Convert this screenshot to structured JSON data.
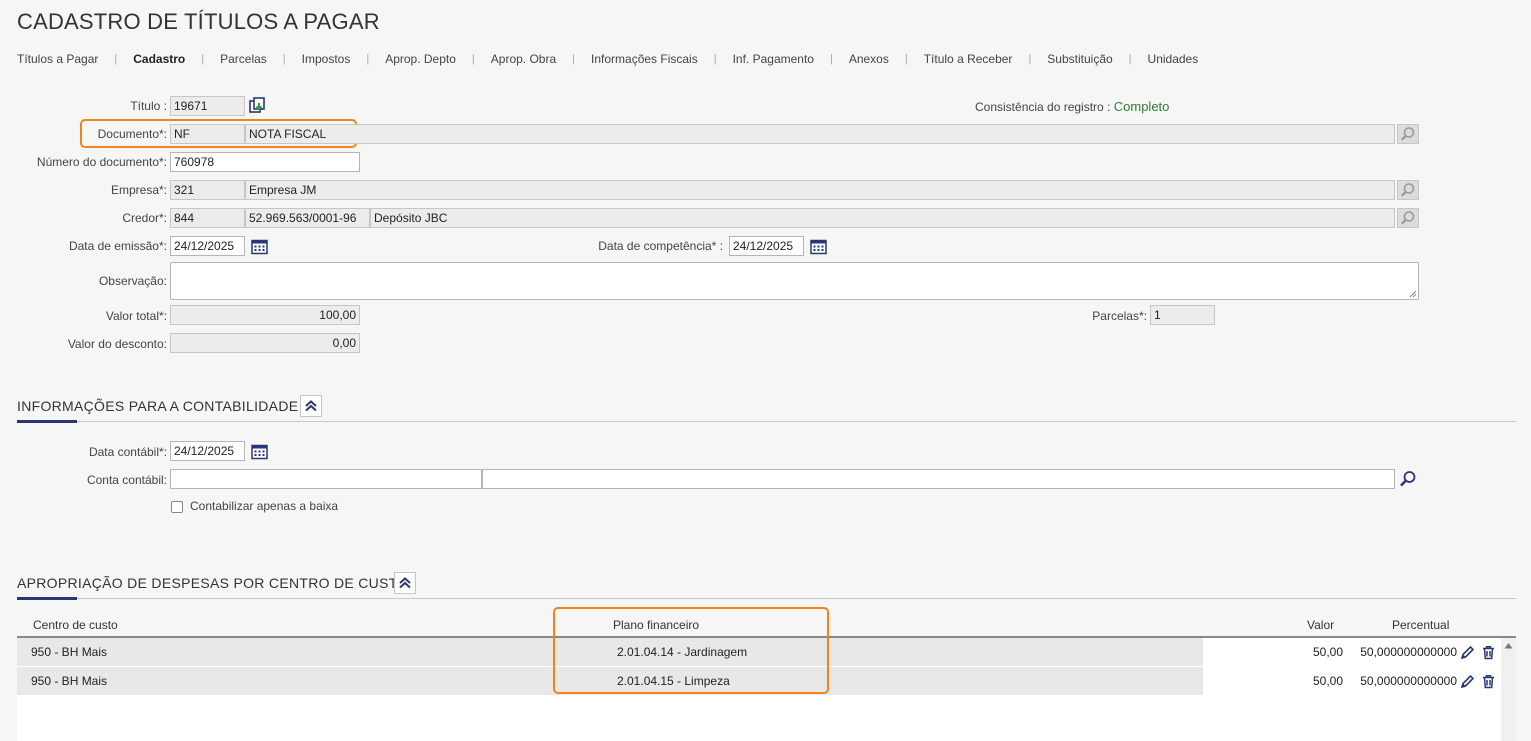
{
  "page": {
    "title": "CADASTRO DE TÍTULOS A PAGAR"
  },
  "tabs": [
    {
      "label": "Títulos a Pagar"
    },
    {
      "label": "Cadastro"
    },
    {
      "label": "Parcelas"
    },
    {
      "label": "Impostos"
    },
    {
      "label": "Aprop. Depto"
    },
    {
      "label": "Aprop. Obra"
    },
    {
      "label": "Informações Fiscais"
    },
    {
      "label": "Inf. Pagamento"
    },
    {
      "label": "Anexos"
    },
    {
      "label": "Título a Receber"
    },
    {
      "label": "Substituição"
    },
    {
      "label": "Unidades"
    }
  ],
  "form": {
    "titulo": {
      "label": "Título :",
      "value": "19671"
    },
    "consistencia": {
      "label": "Consistência do registro :",
      "value": "Completo",
      "color": "#2e7d32"
    },
    "documento": {
      "label": "Documento*:",
      "code": "NF",
      "desc": "NOTA FISCAL"
    },
    "numero_documento": {
      "label": "Número do documento*:",
      "value": "760978"
    },
    "empresa": {
      "label": "Empresa*:",
      "code": "321",
      "desc": "Empresa JM"
    },
    "credor": {
      "label": "Credor*:",
      "code": "844",
      "cnpj": "52.969.563/0001-96",
      "desc": "Depósito JBC"
    },
    "data_emissao": {
      "label": "Data de emissão*:",
      "value": "24/12/2025"
    },
    "data_competencia": {
      "label": "Data de competência* :",
      "value": "24/12/2025"
    },
    "observacao": {
      "label": "Observação:",
      "value": ""
    },
    "valor_total": {
      "label": "Valor total*:",
      "value": "100,00"
    },
    "parcelas": {
      "label": "Parcelas*:",
      "value": "1"
    },
    "valor_desconto": {
      "label": "Valor do desconto:",
      "value": "0,00"
    }
  },
  "contabilidade": {
    "title": "INFORMAÇÕES PARA A CONTABILIDADE",
    "data_contabil": {
      "label": "Data contábil*:",
      "value": "24/12/2025"
    },
    "conta_contabil": {
      "label": "Conta contábil:",
      "code": "",
      "desc": ""
    },
    "contabilizar": {
      "label": "Contabilizar apenas a baixa",
      "checked": false
    }
  },
  "apropriacao": {
    "title": "APROPRIAÇÃO DE DESPESAS POR CENTRO DE CUSTO",
    "columns": {
      "centro": "Centro de custo",
      "plano": "Plano financeiro",
      "valor": "Valor",
      "percentual": "Percentual"
    },
    "rows": [
      {
        "centro": "950 - BH Mais",
        "plano": "2.01.04.14 - Jardinagem",
        "valor": "50,00",
        "percentual": "50,000000000000"
      },
      {
        "centro": "950 - BH Mais",
        "plano": "2.01.04.15 - Limpeza",
        "valor": "50,00",
        "percentual": "50,000000000000"
      }
    ]
  },
  "icons": {
    "copy": "copy-icon",
    "search": "search-icon",
    "calendar": "calendar-icon",
    "collapse": "chevron-double-up-icon",
    "edit": "pencil-icon",
    "delete": "trash-icon"
  },
  "colors": {
    "accent": "#2b3674",
    "highlight": "#f0851e",
    "status_ok": "#2e7d32"
  }
}
